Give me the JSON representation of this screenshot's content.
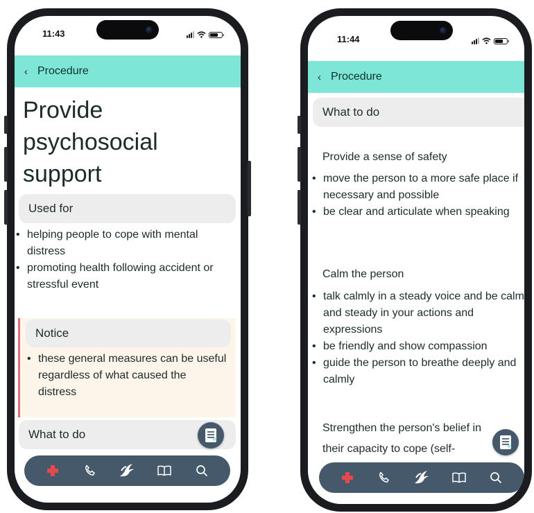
{
  "colors": {
    "nav_bg": "#7ee6d6",
    "tabbar_bg": "#46596b",
    "notice_bg": "#fdf4ea",
    "notice_accent": "#e06a7a",
    "card_bg": "#ededed",
    "cross_red": "#e5484d"
  },
  "phone_left": {
    "status": {
      "time": "11:43"
    },
    "nav": {
      "back_icon": "chevron-left-icon",
      "title": "Procedure"
    },
    "page_title_lines": [
      "Provide",
      "psychosocial",
      "support"
    ],
    "used_for": {
      "heading": "Used for",
      "items": [
        "helping people to cope with mental distress",
        "promoting health following accident or stressful event"
      ]
    },
    "notice": {
      "heading": "Notice",
      "items": [
        "these general measures can be useful regardless of what caused the distress"
      ]
    },
    "what_to_do": {
      "heading": "What to do"
    }
  },
  "phone_right": {
    "status": {
      "time": "11:44"
    },
    "nav": {
      "back_icon": "chevron-left-icon",
      "title": "Procedure"
    },
    "what_to_do": {
      "heading": "What to do"
    },
    "sections": [
      {
        "title": "Provide a sense of safety",
        "items": [
          "move the person to a more safe place if necessary and possible",
          "be clear and articulate when speaking"
        ]
      },
      {
        "title": "Calm the person",
        "items": [
          "talk calmly in a steady voice and be calm and steady in your actions and expressions",
          "be friendly and show compassion",
          "guide the person to breathe deeply and calmly"
        ]
      },
      {
        "title_lines": [
          "Strengthen the person's belief in",
          "their capacity to cope (self-"
        ]
      }
    ]
  },
  "tabbar": {
    "tabs": [
      "first-aid-cross-icon",
      "phone-icon",
      "birds-icon",
      "book-icon",
      "search-icon"
    ]
  },
  "fab": {
    "icon": "document-list-icon"
  }
}
